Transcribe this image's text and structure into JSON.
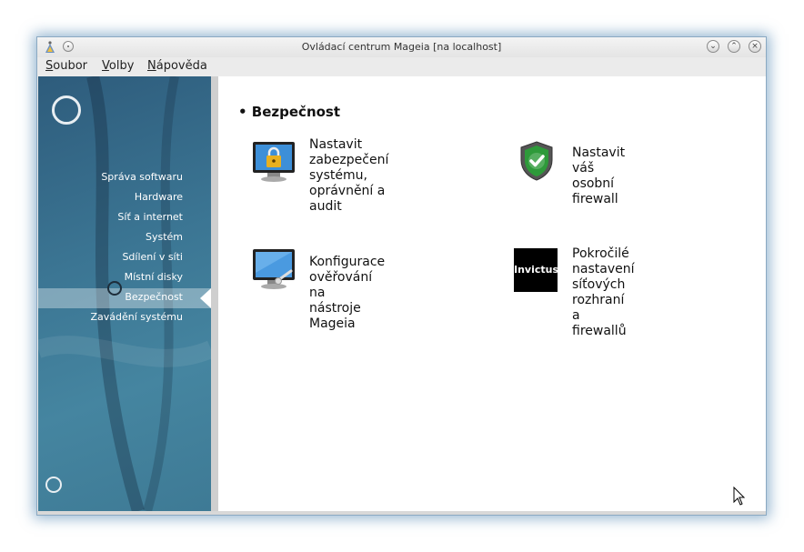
{
  "window": {
    "title": "Ovládací centrum Mageia  [na localhost]"
  },
  "titlebar": {
    "icons": [
      "mageia-app-icon",
      "pin-icon",
      "minimize-icon",
      "maximize-icon",
      "close-icon"
    ]
  },
  "menubar": {
    "items": [
      {
        "mnemonic": "S",
        "rest": "oubor"
      },
      {
        "mnemonic": "V",
        "rest": "olby"
      },
      {
        "mnemonic": "N",
        "rest": "ápověda"
      }
    ]
  },
  "sidebar": {
    "selected": "Bezpečnost",
    "items": [
      {
        "label": "Správa softwaru"
      },
      {
        "label": "Hardware"
      },
      {
        "label": "Síť a internet"
      },
      {
        "label": "Systém"
      },
      {
        "label": "Sdílení v síti"
      },
      {
        "label": "Místní disky"
      },
      {
        "label": "Bezpečnost"
      },
      {
        "label": "Zavádění systému"
      }
    ]
  },
  "main": {
    "section_title": "• Bezpečnost",
    "tools": [
      {
        "line1": "Nastavit zabezpečení",
        "line2": "systému, oprávnění a",
        "line3": "audit",
        "icon": "security-monitor-lock-icon"
      },
      {
        "line1": "Nastavit váš osobní",
        "line2": "firewall",
        "line3": "",
        "icon": "firewall-shield-icon"
      },
      {
        "line1": "Konfigurace ověřování na",
        "line2": "nástroje Mageia",
        "line3": "",
        "icon": "auth-monitor-icon"
      },
      {
        "line1": "Pokročilé nastavení",
        "line2": "síťových rozhraní a",
        "line3": "firewallů",
        "icon": "invictus-logo-icon",
        "logo_text": "Invictus"
      }
    ]
  },
  "colors": {
    "sidebar": "#3b7593",
    "accent": "#2e9a3a",
    "text": "#111111"
  }
}
